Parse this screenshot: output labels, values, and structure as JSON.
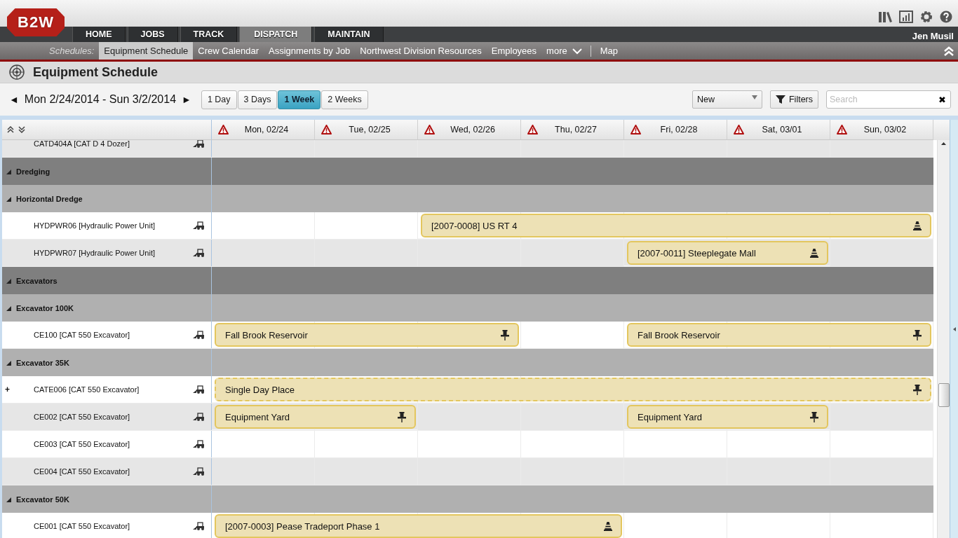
{
  "app": {
    "logo": "B2W",
    "user": "Jen Musil"
  },
  "nav_tabs": [
    {
      "label": "HOME",
      "selected": false
    },
    {
      "label": "JOBS",
      "selected": false
    },
    {
      "label": "TRACK",
      "selected": false
    },
    {
      "label": "DISPATCH",
      "selected": true
    },
    {
      "label": "MAINTAIN",
      "selected": false
    }
  ],
  "subnav": {
    "label": "Schedules:",
    "items": [
      {
        "label": "Equipment Schedule",
        "selected": true
      },
      {
        "label": "Crew Calendar",
        "selected": false
      },
      {
        "label": "Assignments by Job",
        "selected": false
      },
      {
        "label": "Northwest Division Resources",
        "selected": false
      },
      {
        "label": "Employees",
        "selected": false
      }
    ],
    "more": "more",
    "extra": "Map"
  },
  "page_title": "Equipment Schedule",
  "toolbar": {
    "prev": "◄",
    "date_range": "Mon 2/24/2014 - Sun 3/2/2014",
    "next": "►",
    "views": [
      {
        "label": "1 Day",
        "selected": false
      },
      {
        "label": "3 Days",
        "selected": false
      },
      {
        "label": "1 Week",
        "selected": true
      },
      {
        "label": "2 Weeks",
        "selected": false
      }
    ],
    "dropdown": "New",
    "filters": "Filters",
    "search": {
      "placeholder": "Search"
    },
    "clear": "✖"
  },
  "schedule": {
    "days": [
      {
        "label": "Mon, 02/24",
        "warning": true
      },
      {
        "label": "Tue, 02/25",
        "warning": true
      },
      {
        "label": "Wed, 02/26",
        "warning": true
      },
      {
        "label": "Thu, 02/27",
        "warning": true
      },
      {
        "label": "Fri, 02/28",
        "warning": true
      },
      {
        "label": "Sat, 03/01",
        "warning": true
      },
      {
        "label": "Sun, 03/02",
        "warning": true
      }
    ],
    "rows": [
      {
        "kind": "equipment",
        "label": "CATD404A [CAT D 4 Dozer]",
        "shaded": true
      },
      {
        "kind": "category",
        "label": "Dredging",
        "expanded": true
      },
      {
        "kind": "group",
        "label": "Horizontal Dredge",
        "expanded": true
      },
      {
        "kind": "equipment",
        "label": "HYDPWR06 [Hydraulic Power Unit]",
        "shaded": false,
        "booked": [
          false,
          false,
          true,
          true,
          true,
          true,
          true
        ],
        "bookings": [
          {
            "label": "[2007-0008] US RT 4",
            "kind": "cone",
            "tentative": false
          }
        ]
      },
      {
        "kind": "equipment",
        "label": "HYDPWR07 [Hydraulic Power Unit]",
        "shaded": true,
        "booked": [
          false,
          false,
          false,
          false,
          true,
          true,
          false
        ],
        "bookings": [
          {
            "label": "[2007-0011] Steeplegate Mall",
            "kind": "cone",
            "tentative": false
          }
        ]
      },
      {
        "kind": "category",
        "label": "Excavators",
        "expanded": true
      },
      {
        "kind": "group",
        "label": "Excavator 100K",
        "expanded": true
      },
      {
        "kind": "equipment",
        "label": "CE100 [CAT 550 Excavator]",
        "shaded": false,
        "booked": [
          true,
          true,
          true,
          false,
          true,
          true,
          true
        ],
        "bookings": [
          {
            "label": "Fall Brook Reservoir",
            "kind": "pin",
            "tentative": false
          },
          {
            "label": "Fall Brook Reservoir",
            "kind": "pin",
            "tentative": false
          }
        ]
      },
      {
        "kind": "group",
        "label": "Excavator 35K",
        "expanded": true
      },
      {
        "kind": "equipment",
        "label": "CATE006 [CAT 550 Excavator]",
        "marker": "+",
        "shaded": false,
        "booked": [
          true,
          true,
          true,
          true,
          true,
          true,
          true
        ],
        "bookings": [
          {
            "label": "Single Day Place",
            "kind": "pin",
            "tentative": true
          }
        ]
      },
      {
        "kind": "equipment",
        "label": "CE002 [CAT 550 Excavator]",
        "shaded": true,
        "booked": [
          true,
          true,
          false,
          false,
          true,
          true,
          false
        ],
        "bookings": [
          {
            "label": "Equipment Yard",
            "kind": "pin",
            "tentative": false
          },
          {
            "label": "Equipment Yard",
            "kind": "pin",
            "tentative": false
          }
        ]
      },
      {
        "kind": "equipment",
        "label": "CE003 [CAT 550 Excavator]",
        "shaded": false
      },
      {
        "kind": "equipment",
        "label": "CE004 [CAT 550 Excavator]",
        "shaded": true
      },
      {
        "kind": "group",
        "label": "Excavator 50K",
        "expanded": true
      },
      {
        "kind": "equipment",
        "label": "CE001 [CAT 550 Excavator]",
        "shaded": false,
        "booked": [
          true,
          true,
          true,
          true,
          false,
          false,
          false
        ],
        "bookings": [
          {
            "label": "[2007-0003] Pease Tradeport Phase 1",
            "kind": "cone",
            "tentative": false
          }
        ]
      }
    ]
  }
}
